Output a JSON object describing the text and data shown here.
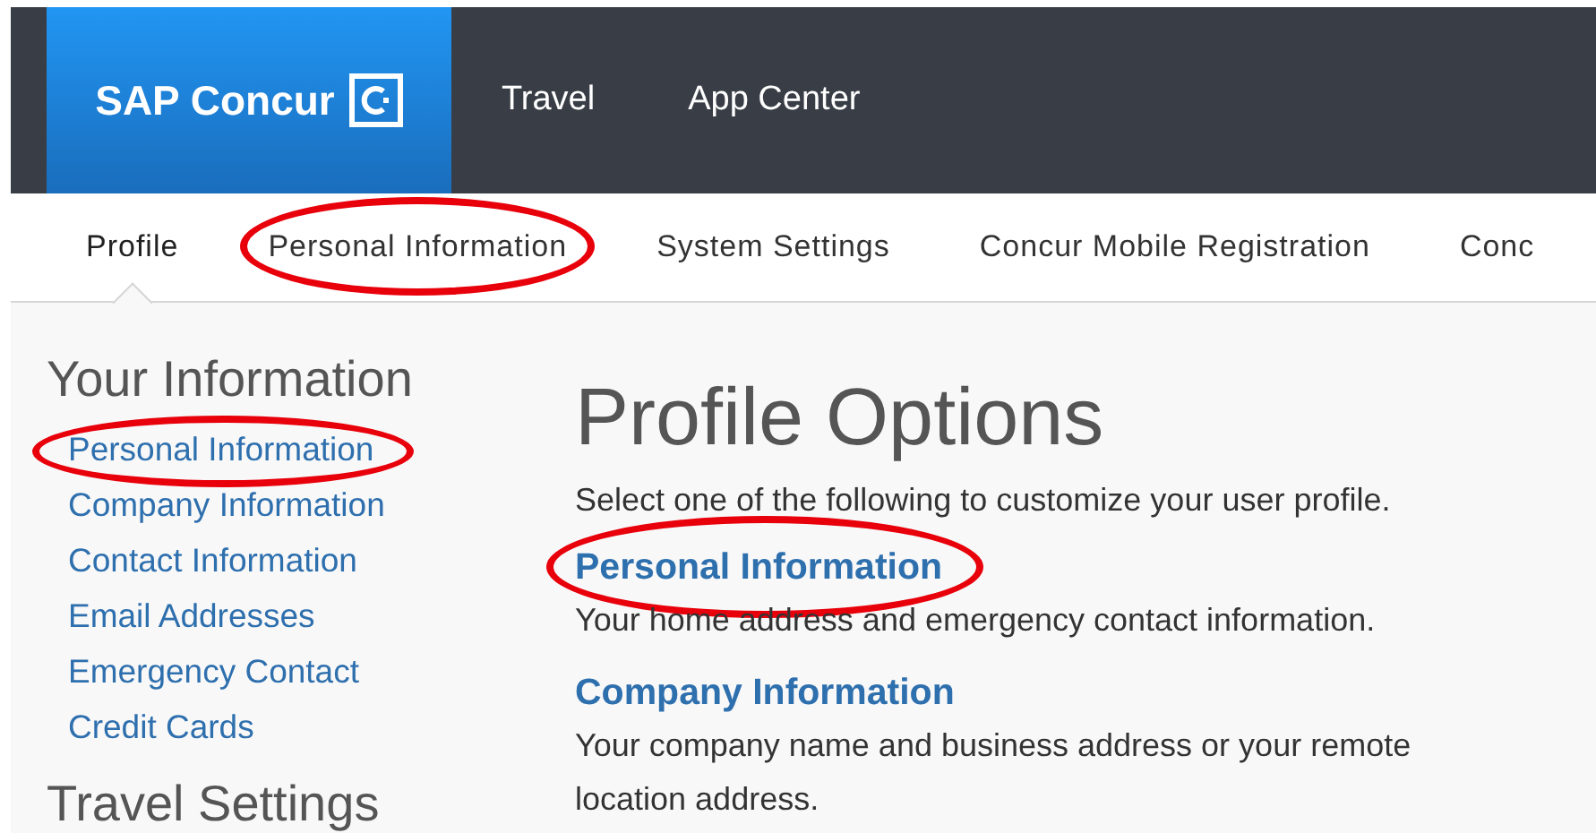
{
  "header": {
    "logo": "SAP Concur",
    "nav": [
      {
        "label": "Travel"
      },
      {
        "label": "App Center"
      }
    ]
  },
  "subnav": [
    {
      "label": "Profile",
      "selected": true,
      "highlighted": false
    },
    {
      "label": "Personal Information",
      "selected": false,
      "highlighted": true
    },
    {
      "label": "System Settings",
      "selected": false,
      "highlighted": false
    },
    {
      "label": "Concur Mobile Registration",
      "selected": false,
      "highlighted": false
    },
    {
      "label": "Conc",
      "selected": false,
      "highlighted": false
    }
  ],
  "sidebar": {
    "sections": [
      {
        "title": "Your Information",
        "items": [
          {
            "label": "Personal Information",
            "highlighted": true
          },
          {
            "label": "Company Information",
            "highlighted": false
          },
          {
            "label": "Contact Information",
            "highlighted": false
          },
          {
            "label": "Email Addresses",
            "highlighted": false
          },
          {
            "label": "Emergency Contact",
            "highlighted": false
          },
          {
            "label": "Credit Cards",
            "highlighted": false
          }
        ]
      },
      {
        "title": "Travel Settings"
      }
    ]
  },
  "main": {
    "title": "Profile Options",
    "intro": "Select one of the following to customize your user profile.",
    "options": [
      {
        "label": "Personal Information",
        "description": "Your home address and emergency contact information.",
        "highlighted": true
      },
      {
        "label": "Company Information",
        "description": "Your company name and business address or your remote location address.",
        "highlighted": false
      }
    ]
  }
}
